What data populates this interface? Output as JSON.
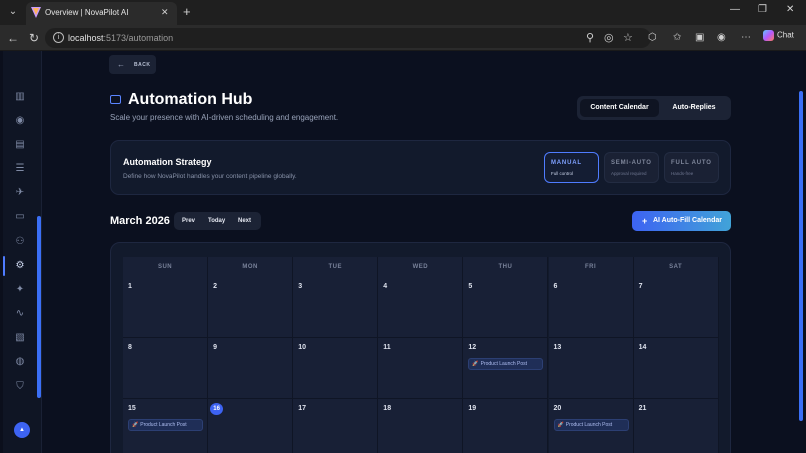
{
  "browser": {
    "tab_title": "Overview | NovaPilot AI",
    "url_host": "localhost",
    "url_path": ":5173/automation",
    "chat_label": "Chat"
  },
  "page": {
    "back_label": "BACK",
    "title": "Automation Hub",
    "subtitle": "Scale your presence with AI-driven scheduling and engagement.",
    "view_tabs": [
      {
        "label": "Content Calendar",
        "active": true
      },
      {
        "label": "Auto-Replies",
        "active": false
      }
    ]
  },
  "strategy": {
    "title": "Automation Strategy",
    "subtitle": "Define how NovaPilot handles your content pipeline globally.",
    "modes": [
      {
        "title": "MANUAL",
        "subtitle": "Full control",
        "selected": true
      },
      {
        "title": "SEMI-AUTO",
        "subtitle": "Approval required",
        "selected": false
      },
      {
        "title": "FULL AUTO",
        "subtitle": "Hands-free",
        "selected": false
      }
    ]
  },
  "calendar": {
    "month_label": "March 2026",
    "prev_label": "Prev",
    "today_label": "Today",
    "next_label": "Next",
    "autofill_label": "AI Auto-Fill Calendar",
    "weekdays": [
      "SUN",
      "MON",
      "TUE",
      "WED",
      "THU",
      "FRI",
      "SAT"
    ],
    "weeks": [
      [
        {
          "day": "1"
        },
        {
          "day": "2"
        },
        {
          "day": "3"
        },
        {
          "day": "4"
        },
        {
          "day": "5"
        },
        {
          "day": "6"
        },
        {
          "day": "7"
        }
      ],
      [
        {
          "day": "8"
        },
        {
          "day": "9"
        },
        {
          "day": "10"
        },
        {
          "day": "11"
        },
        {
          "day": "12",
          "event": "Product Launch Post"
        },
        {
          "day": "13"
        },
        {
          "day": "14"
        }
      ],
      [
        {
          "day": "15",
          "event": "Product Launch Post"
        },
        {
          "day": "16",
          "today": true
        },
        {
          "day": "17"
        },
        {
          "day": "18"
        },
        {
          "day": "19"
        },
        {
          "day": "20",
          "event": "Product Launch Post"
        },
        {
          "day": "21"
        }
      ]
    ]
  },
  "sidebar": {
    "icons": [
      "chart-icon",
      "eye-icon",
      "document-icon",
      "database-icon",
      "rocket-icon",
      "file-icon",
      "users-icon",
      "gear-icon",
      "magic-wand-icon",
      "activity-icon",
      "ticket-icon",
      "support-icon",
      "shield-icon"
    ],
    "avatar_label": "▲"
  },
  "colors": {
    "accent": "#3d63f2",
    "background": "#0b101f",
    "card": "#121a2c"
  }
}
